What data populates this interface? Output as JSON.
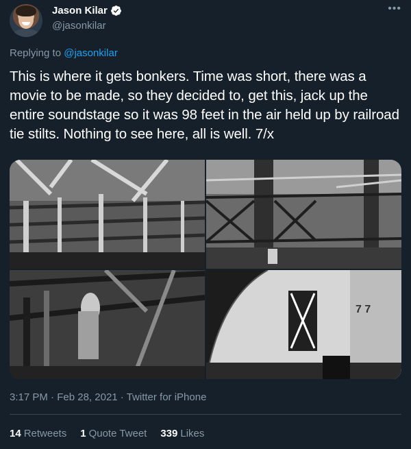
{
  "author": {
    "display_name": "Jason Kilar",
    "handle": "@jasonkilar",
    "verified": true
  },
  "reply": {
    "prefix": "Replying to ",
    "to": "@jasonkilar"
  },
  "tweet": {
    "text": "This is where it gets bonkers. Time was short, there was a movie to be made, so they decided to, get this, jack up the entire soundstage so it was 98 feet in the air held up by railroad tie stilts. Nothing to see here, all is well. 7/x"
  },
  "media": {
    "photos": [
      {
        "icon": "photo-scaffolding-underside"
      },
      {
        "icon": "photo-scaffolding-frame"
      },
      {
        "icon": "photo-worker-beams"
      },
      {
        "icon": "photo-soundstage-wall"
      }
    ]
  },
  "meta": {
    "time": "3:17 PM",
    "date": "Feb 28, 2021",
    "source": "Twitter for iPhone",
    "separator": " · "
  },
  "stats": {
    "retweets_count": "14",
    "retweets_label": "Retweets",
    "quotes_count": "1",
    "quotes_label": "Quote Tweet",
    "likes_count": "339",
    "likes_label": "Likes"
  },
  "photo4_markings": "7 7",
  "colors": {
    "background": "#15202b",
    "secondary_text": "#8899a6",
    "link": "#1da1f2",
    "divider": "#38444d"
  }
}
